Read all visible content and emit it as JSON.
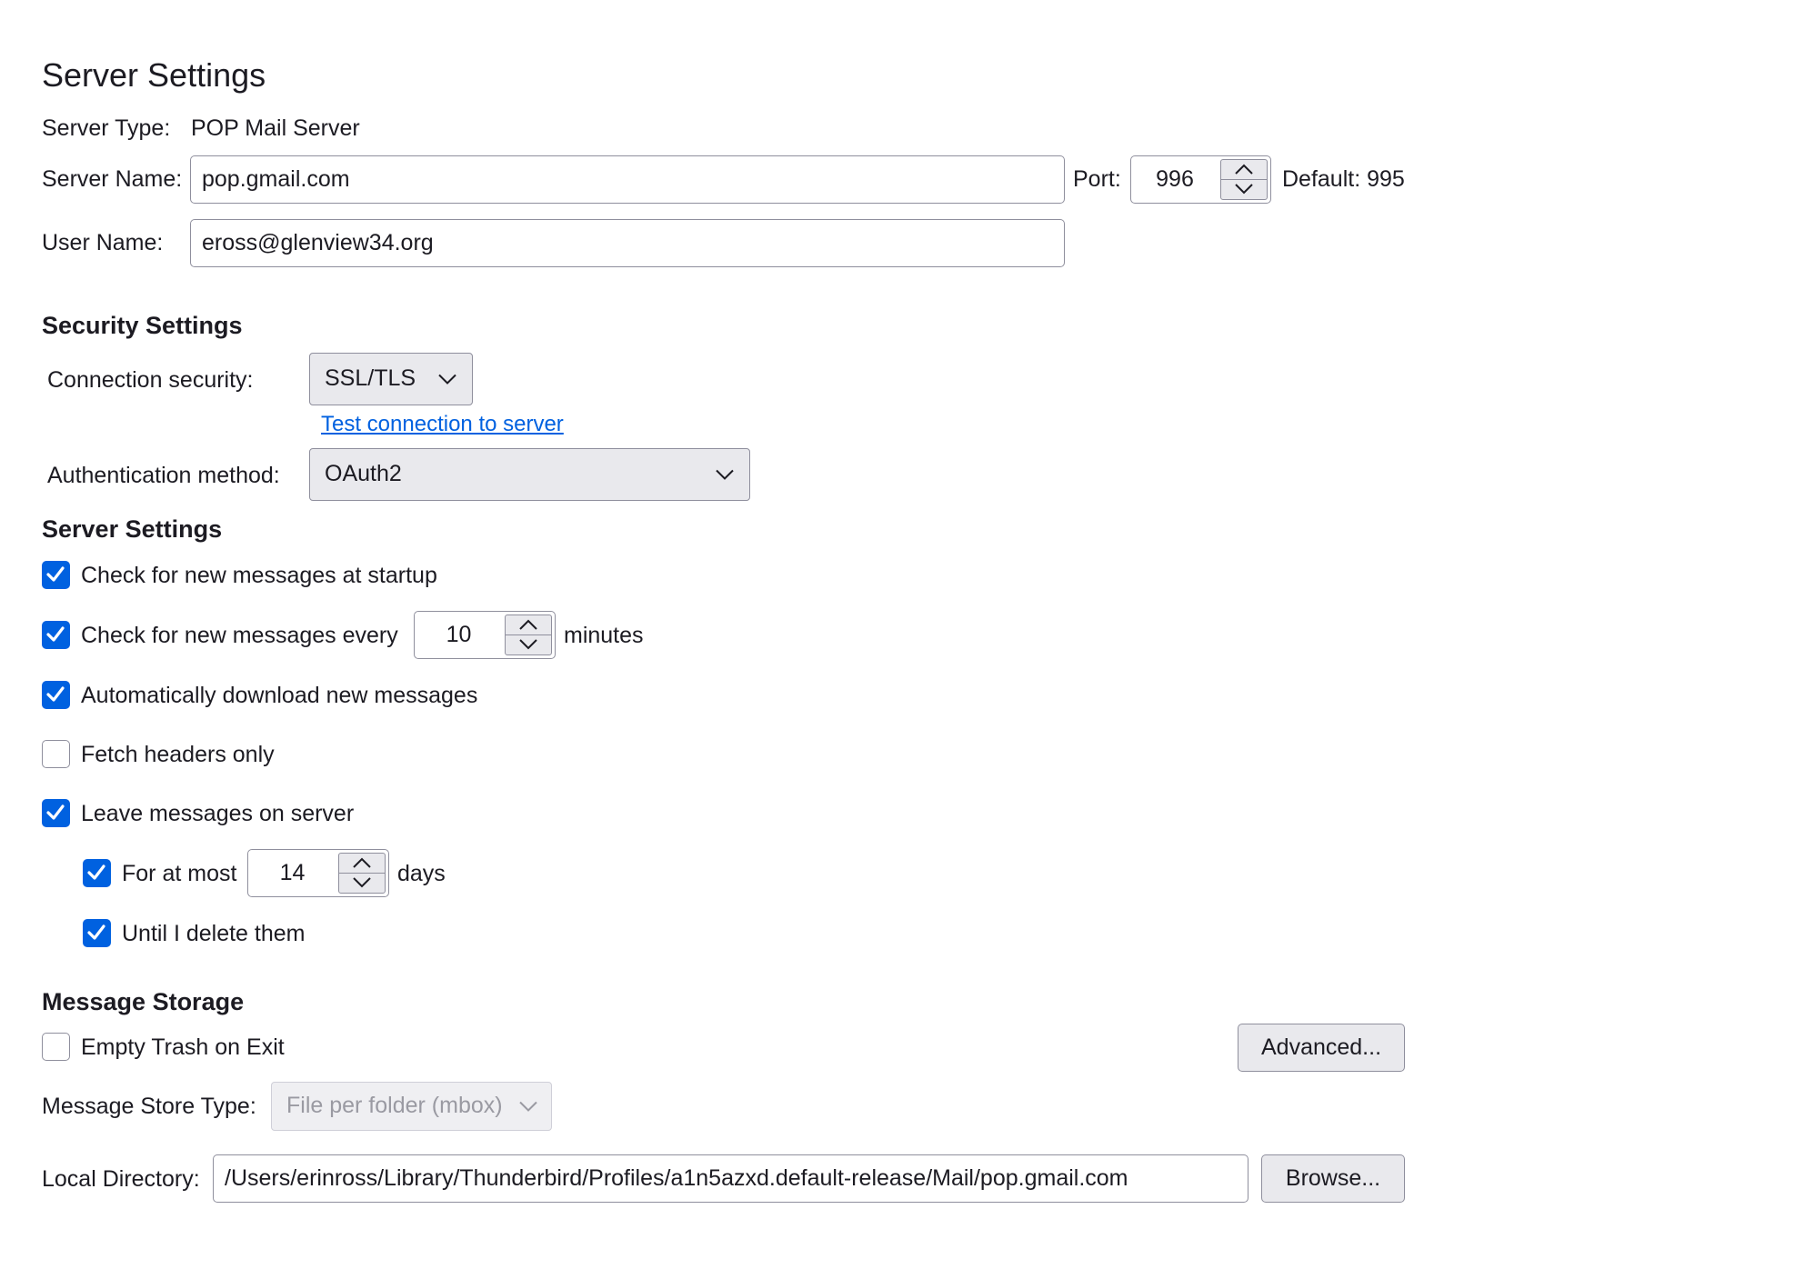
{
  "page_title": "Server Settings",
  "server": {
    "type_label": "Server Type:",
    "type_value": "POP Mail Server",
    "name_label": "Server Name:",
    "name_value": "pop.gmail.com",
    "port_label": "Port:",
    "port_value": "996",
    "default_label": "Default:",
    "default_value": "995",
    "user_label": "User Name:",
    "user_value": "eross@glenview34.org"
  },
  "security": {
    "heading": "Security Settings",
    "connection_label": "Connection security:",
    "connection_value": "SSL/TLS",
    "test_link": "Test connection to server",
    "auth_label": "Authentication method:",
    "auth_value": "OAuth2"
  },
  "settings": {
    "heading": "Server Settings",
    "check_startup": {
      "label": "Check for new messages at startup",
      "checked": true
    },
    "check_every": {
      "label": "Check for new messages every",
      "value": "10",
      "unit": "minutes",
      "checked": true
    },
    "auto_download": {
      "label": "Automatically download new messages",
      "checked": true
    },
    "headers_only": {
      "label": "Fetch headers only",
      "checked": false
    },
    "leave_on_server": {
      "label": "Leave messages on server",
      "checked": true
    },
    "for_at_most": {
      "label": "For at most",
      "value": "14",
      "unit": "days",
      "checked": true
    },
    "until_delete": {
      "label": "Until I delete them",
      "checked": true
    }
  },
  "storage": {
    "heading": "Message Storage",
    "empty_trash": {
      "label": "Empty Trash on Exit",
      "checked": false
    },
    "advanced_button": "Advanced...",
    "store_type_label": "Message Store Type:",
    "store_type_value": "File per folder (mbox)",
    "local_dir_label": "Local Directory:",
    "local_dir_value": "/Users/erinross/Library/Thunderbird/Profiles/a1n5azxd.default-release/Mail/pop.gmail.com",
    "browse_button": "Browse..."
  },
  "colors": {
    "accent": "#0061e0",
    "border": "#8f8f9d",
    "button_bg": "#e9e9ed"
  }
}
